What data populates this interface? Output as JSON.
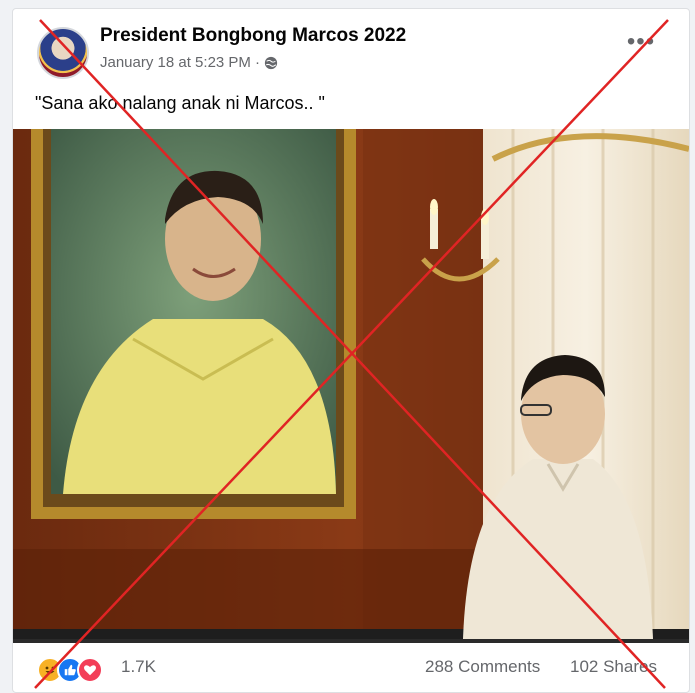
{
  "post": {
    "author": "President Bongbong Marcos 2022",
    "date": "January 18 at 5:23 PM",
    "separator": "·",
    "audience_icon": "globe-icon",
    "more_label": "•••",
    "caption": "\"Sana ako nalang anak ni Marcos.. \""
  },
  "footer": {
    "reactions": [
      "haha-icon",
      "like-icon",
      "love-icon"
    ],
    "reaction_count": "1.7K",
    "comments": "288 Comments",
    "shares": "102 Shares"
  },
  "colors": {
    "overlay_x": "#e02424",
    "like": "#1877f2",
    "love": "#f33e58",
    "haha": "#f7b125"
  }
}
